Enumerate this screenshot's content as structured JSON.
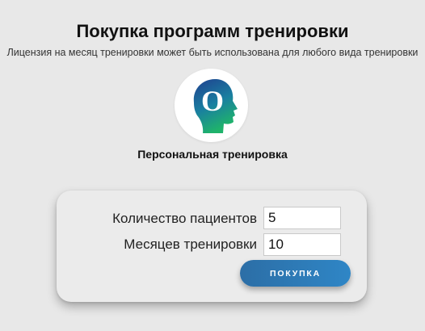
{
  "header": {
    "title": "Покупка программ тренировки",
    "subtitle": "Лицензия на месяц тренировки может быть использована для любого вида тренировки"
  },
  "product": {
    "logo_icon": "head-profile-icon",
    "logo_letter": "O",
    "name": "Персональная тренировка",
    "colors": {
      "navy": "#1f3f8f",
      "teal": "#16a08a",
      "green": "#1fb36b"
    }
  },
  "form": {
    "patients_label": "Количество пациентов",
    "patients_value": "5",
    "months_label": "Месяцев тренировки",
    "months_value": "10",
    "buy_button": "ПОКУПКА",
    "button_color": "#2d78b8"
  }
}
